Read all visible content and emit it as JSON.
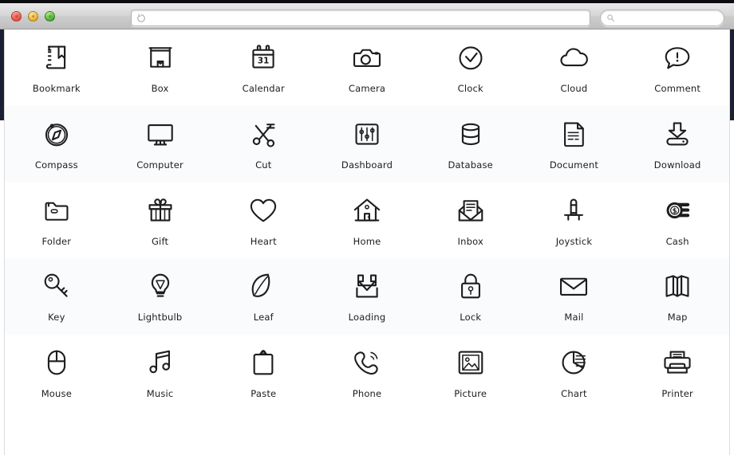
{
  "window": {
    "traffic_lights": [
      "close",
      "minimize",
      "maximize"
    ]
  },
  "toolbar": {
    "address": {
      "icon": "loading-spinner-icon",
      "value": "",
      "placeholder": ""
    },
    "search": {
      "icon": "search-icon",
      "value": "",
      "placeholder": ""
    }
  },
  "gallery": {
    "columns": 7,
    "rows": [
      {
        "shaded": false,
        "items": [
          {
            "label": "Bookmark",
            "icon": "bookmark-icon"
          },
          {
            "label": "Box",
            "icon": "box-icon"
          },
          {
            "label": "Calendar",
            "icon": "calendar-icon",
            "day": "31"
          },
          {
            "label": "Camera",
            "icon": "camera-icon"
          },
          {
            "label": "Clock",
            "icon": "clock-icon"
          },
          {
            "label": "Cloud",
            "icon": "cloud-icon"
          },
          {
            "label": "Comment",
            "icon": "comment-icon"
          }
        ]
      },
      {
        "shaded": true,
        "items": [
          {
            "label": "Compass",
            "icon": "compass-icon"
          },
          {
            "label": "Computer",
            "icon": "computer-icon"
          },
          {
            "label": "Cut",
            "icon": "scissors-icon"
          },
          {
            "label": "Dashboard",
            "icon": "dashboard-icon"
          },
          {
            "label": "Database",
            "icon": "database-icon"
          },
          {
            "label": "Document",
            "icon": "document-icon"
          },
          {
            "label": "Download",
            "icon": "download-icon"
          }
        ]
      },
      {
        "shaded": false,
        "items": [
          {
            "label": "Folder",
            "icon": "folder-icon"
          },
          {
            "label": "Gift",
            "icon": "gift-icon"
          },
          {
            "label": "Heart",
            "icon": "heart-icon"
          },
          {
            "label": "Home",
            "icon": "home-icon"
          },
          {
            "label": "Inbox",
            "icon": "inbox-icon"
          },
          {
            "label": "Joystick",
            "icon": "joystick-icon"
          },
          {
            "label": "Cash",
            "icon": "cash-icon"
          }
        ]
      },
      {
        "shaded": true,
        "items": [
          {
            "label": "Key",
            "icon": "key-icon"
          },
          {
            "label": "Lightbulb",
            "icon": "lightbulb-icon"
          },
          {
            "label": "Leaf",
            "icon": "leaf-icon"
          },
          {
            "label": "Loading",
            "icon": "loading-icon"
          },
          {
            "label": "Lock",
            "icon": "lock-icon"
          },
          {
            "label": "Mail",
            "icon": "mail-icon"
          },
          {
            "label": "Map",
            "icon": "map-icon"
          }
        ]
      },
      {
        "shaded": false,
        "items": [
          {
            "label": "Mouse",
            "icon": "mouse-icon"
          },
          {
            "label": "Music",
            "icon": "music-icon"
          },
          {
            "label": "Paste",
            "icon": "clipboard-icon"
          },
          {
            "label": "Phone",
            "icon": "phone-icon"
          },
          {
            "label": "Picture",
            "icon": "picture-icon"
          },
          {
            "label": "Chart",
            "icon": "pie-chart-icon"
          },
          {
            "label": "Printer",
            "icon": "printer-icon"
          }
        ]
      }
    ]
  },
  "colors": {
    "stroke": "#1d1d1f",
    "bezel": "#1a1f33",
    "row_shade": "#fafbfc",
    "background": "#ffffff"
  }
}
